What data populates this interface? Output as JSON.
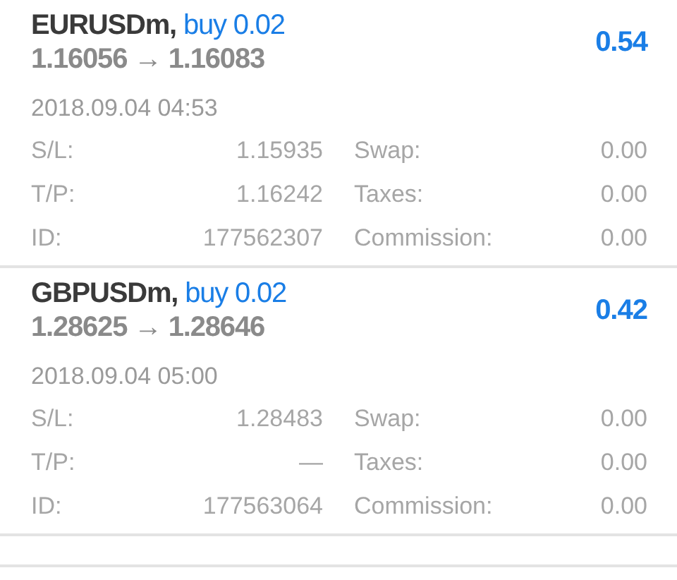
{
  "positions": [
    {
      "symbol": "EURUSDm,",
      "order": "buy 0.02",
      "prices": "1.16056 → 1.16083",
      "profit": "0.54",
      "time": "2018.09.04 04:53",
      "details": [
        {
          "label": "S/L:",
          "value": "1.15935",
          "label_2": "Swap:",
          "value_2": "0.00"
        },
        {
          "label": "T/P:",
          "value": "1.16242",
          "label_2": "Taxes:",
          "value_2": "0.00"
        },
        {
          "label": "ID:",
          "value": "177562307",
          "label_2": "Commission:",
          "value_2": "0.00"
        }
      ]
    },
    {
      "symbol": "GBPUSDm,",
      "order": "buy 0.02",
      "prices": "1.28625 → 1.28646",
      "profit": "0.42",
      "time": "2018.09.04 05:00",
      "details": [
        {
          "label": "S/L:",
          "value": "1.28483",
          "label_2": "Swap:",
          "value_2": "0.00"
        },
        {
          "label": "T/P:",
          "value": "—",
          "label_2": "Taxes:",
          "value_2": "0.00"
        },
        {
          "label": "ID:",
          "value": "177563064",
          "label_2": "Commission:",
          "value_2": "0.00"
        }
      ]
    }
  ]
}
